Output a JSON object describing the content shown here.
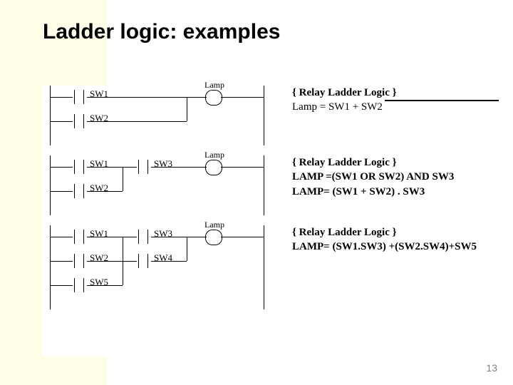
{
  "title": "Ladder logic: examples",
  "page_number": "13",
  "examples": [
    {
      "header": "{ Relay Ladder Logic }",
      "equations": [
        "Lamp = SW1 + SW2"
      ],
      "output_label": "Lamp",
      "rows": [
        {
          "contacts": [
            "SW1"
          ]
        },
        {
          "contacts": [
            "SW2"
          ]
        }
      ]
    },
    {
      "header": "{ Relay Ladder Logic }",
      "equations": [
        "LAMP =(SW1 OR SW2)  AND SW3",
        "LAMP= (SW1 + SW2) . SW3"
      ],
      "output_label": "Lamp",
      "rows": [
        {
          "contacts": [
            "SW1",
            "SW3"
          ]
        },
        {
          "contacts": [
            "SW2"
          ]
        }
      ]
    },
    {
      "header": "{ Relay Ladder Logic }",
      "equations": [
        "LAMP= (SW1.SW3) +(SW2.SW4)+SW5"
      ],
      "output_label": "Lamp",
      "rows": [
        {
          "contacts": [
            "SW1",
            "SW3"
          ]
        },
        {
          "contacts": [
            "SW2",
            "SW4"
          ]
        },
        {
          "contacts": [
            "SW5"
          ]
        }
      ]
    }
  ]
}
